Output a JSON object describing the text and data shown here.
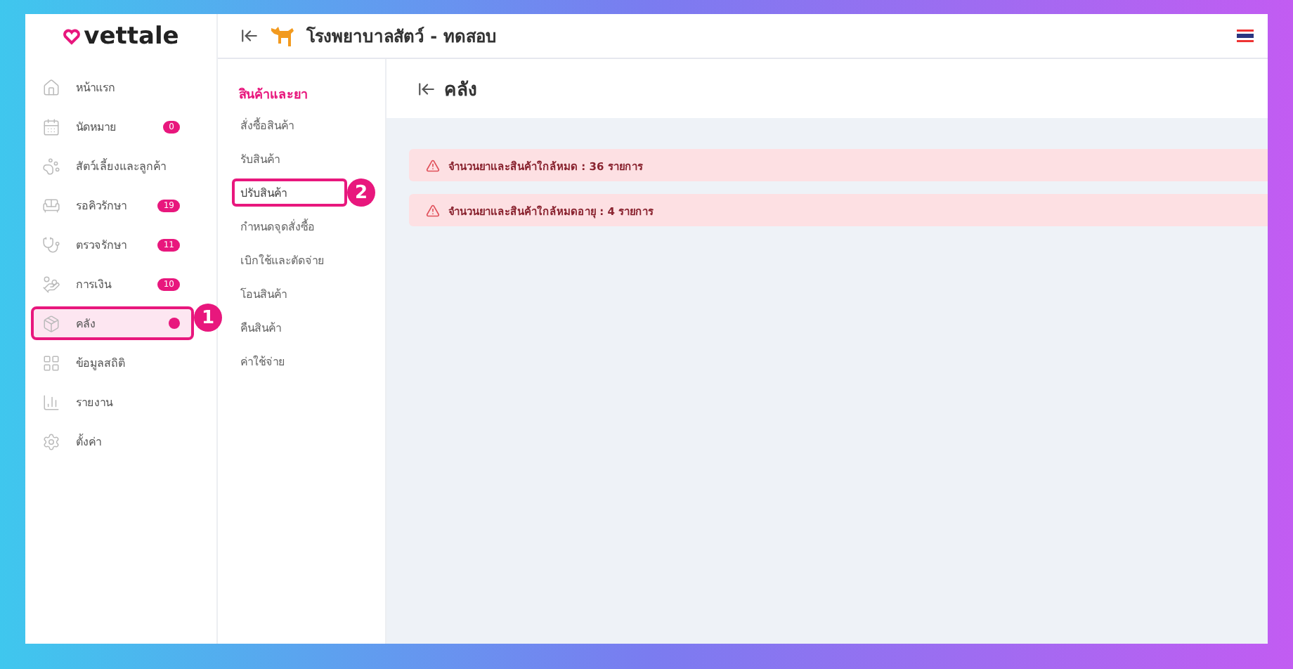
{
  "brand": {
    "logo": "vettale"
  },
  "header": {
    "clinic_name": "โรงพยาบาลสัตว์ - ทดสอบ"
  },
  "sidebar": {
    "items": [
      {
        "label": "หน้าแรก",
        "selected": false,
        "has_dot": false
      },
      {
        "label": "นัดหมาย",
        "badge": "0",
        "selected": false,
        "has_dot": false
      },
      {
        "label": "สัตว์เลี้ยงและลูกค้า",
        "selected": false,
        "has_dot": false
      },
      {
        "label": "รอคิวรักษา",
        "badge": "19",
        "selected": false,
        "has_dot": false
      },
      {
        "label": "ตรวจรักษา",
        "badge": "11",
        "selected": false,
        "has_dot": false
      },
      {
        "label": "การเงิน",
        "badge": "10",
        "selected": false,
        "has_dot": false
      },
      {
        "label": "คลัง",
        "selected": true,
        "has_dot": true,
        "callout": "1"
      },
      {
        "label": "ข้อมูลสถิติ",
        "selected": false,
        "has_dot": false
      },
      {
        "label": "รายงาน",
        "selected": false,
        "has_dot": false
      },
      {
        "label": "ตั้งค่า",
        "selected": false,
        "has_dot": false
      }
    ]
  },
  "submenu": {
    "title": "สินค้าและยา",
    "items": [
      {
        "label": "สั่งซื้อสินค้า",
        "selected": false
      },
      {
        "label": "รับสินค้า",
        "selected": false
      },
      {
        "label": "ปรับสินค้า",
        "selected": true,
        "callout": "2"
      },
      {
        "label": "กำหนดจุดสั่งซื้อ",
        "selected": false
      },
      {
        "label": "เบิกใช้และตัดจ่าย",
        "selected": false
      },
      {
        "label": "โอนสินค้า",
        "selected": false
      },
      {
        "label": "คืนสินค้า",
        "selected": false
      },
      {
        "label": "ค่าใช้จ่าย",
        "selected": false
      }
    ]
  },
  "content": {
    "title": "คลัง",
    "alerts": [
      {
        "text": "จำนวนยาและสินค้าใกล้หมด : 36 รายการ"
      },
      {
        "text": "จำนวนยาและสินค้าใกล้หมดอายุ : 4 รายการ"
      }
    ]
  }
}
